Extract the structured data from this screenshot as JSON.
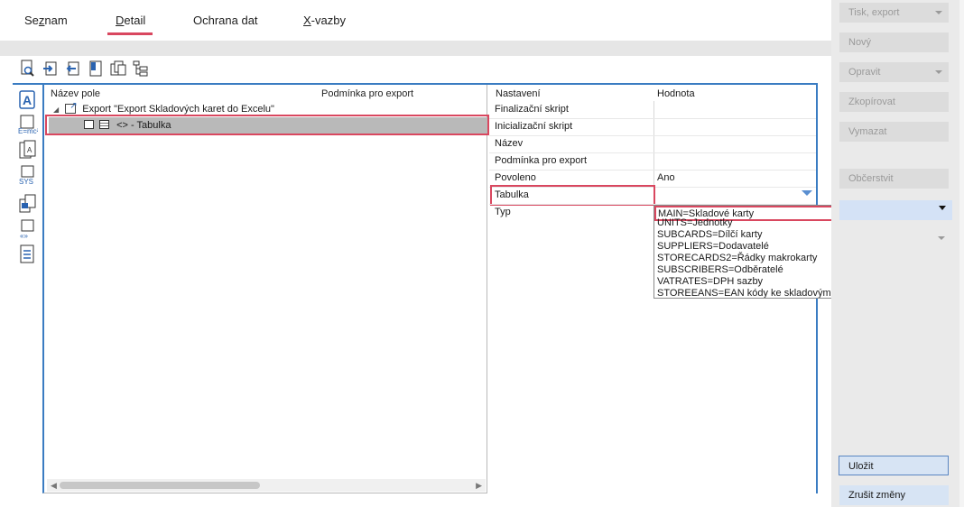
{
  "tabs": [
    {
      "label": "Seznam"
    },
    {
      "label": "Detail"
    },
    {
      "label": "Ochrana dat"
    },
    {
      "label": "X-vazby"
    }
  ],
  "active_tab": "Detail",
  "tree": {
    "col_name": "Název pole",
    "col_condition": "Podmínka pro export",
    "root_label": "Export \"Export Skladových karet do Excelu\"",
    "child_label": "<> - Tabulka"
  },
  "grid": {
    "col_setting": "Nastavení",
    "col_value": "Hodnota",
    "rows": [
      {
        "name": "Finalizační skript",
        "value": ""
      },
      {
        "name": "Inicializační skript",
        "value": ""
      },
      {
        "name": "Název",
        "value": ""
      },
      {
        "name": "Podmínka pro export",
        "value": ""
      },
      {
        "name": "Povoleno",
        "value": "Ano"
      },
      {
        "name": "Tabulka",
        "value": ""
      },
      {
        "name": "Typ",
        "value": ""
      }
    ]
  },
  "dropdown": {
    "selected": "MAIN=Skladové karty",
    "items": [
      "UNITS=Jednotky",
      "SUBCARDS=Dílčí karty",
      "SUPPLIERS=Dodavatelé",
      "STORECARDS2=Řádky makrokarty",
      "SUBSCRIBERS=Odběratelé",
      "VATRATES=DPH sazby",
      "STOREEANS=EAN kódy ke skladovým jednotkám"
    ]
  },
  "sidebar": {
    "buttons": [
      {
        "label": "Tisk, export",
        "dropdown": true
      },
      {
        "label": "Nový",
        "dropdown": false
      },
      {
        "label": "Opravit",
        "dropdown": true
      },
      {
        "label": "Zkopírovat",
        "dropdown": false
      },
      {
        "label": "Vymazat",
        "dropdown": false
      },
      {
        "label": "Občerstvit",
        "dropdown": false
      }
    ],
    "save_label": "Uložit",
    "cancel_label": "Zrušit změny"
  },
  "colors": {
    "accent": "#3a7cc2",
    "highlight": "#d9475f",
    "selection": "#b9b9b9"
  }
}
